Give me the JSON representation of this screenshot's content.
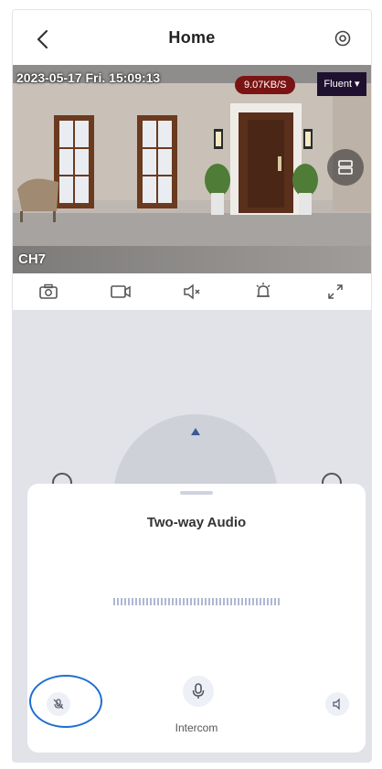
{
  "header": {
    "title": "Home",
    "back_icon": "chevron-left-icon",
    "settings_icon": "settings-icon"
  },
  "video": {
    "datetime": "2023-05-17  Fri.   15:09:13",
    "data_rate": "9.07KB/S",
    "quality": "Fluent ▾",
    "channel": "CH7",
    "split_icon": "split-screen-icon"
  },
  "toolbar": {
    "icons": [
      "camera-icon",
      "video-record-icon",
      "speaker-mute-icon",
      "alarm-bell-icon",
      "fullscreen-icon"
    ]
  },
  "ptz": {
    "up_icon": "arrow-up-icon"
  },
  "audio_sheet": {
    "title": "Two-way Audio",
    "intercom_label": "Intercom",
    "left_icon": "microphone-off-icon",
    "center_icon": "microphone-icon",
    "right_icon": "speaker-icon"
  },
  "colors": {
    "accent_ring": "#1f6fd0",
    "rate_badge": "#7a1414",
    "panel_bg": "#e1e3e8"
  }
}
